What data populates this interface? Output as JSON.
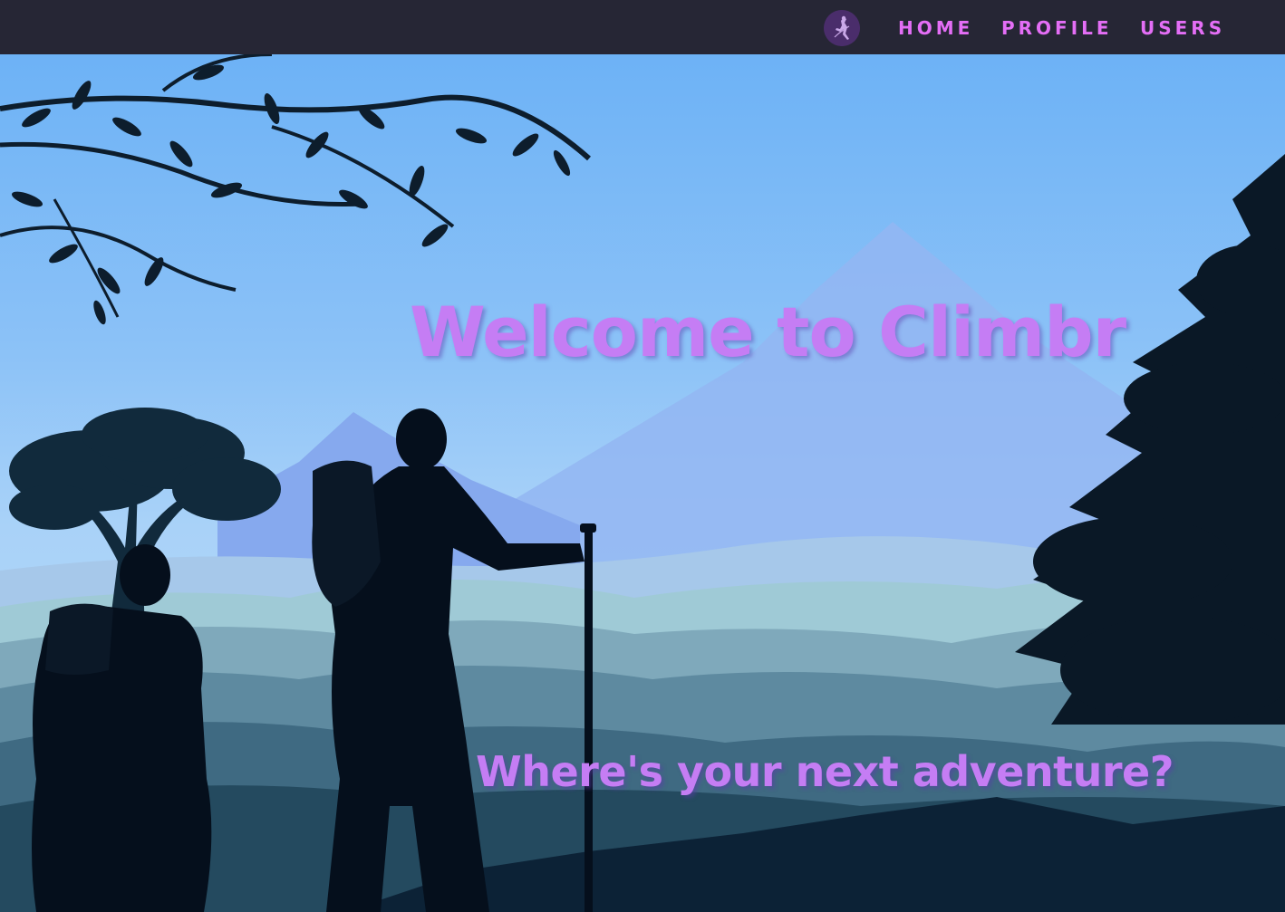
{
  "nav": {
    "logo_icon": "climber-icon",
    "links": [
      {
        "label": "HOME"
      },
      {
        "label": "PROFILE"
      },
      {
        "label": "USERS"
      }
    ]
  },
  "hero": {
    "title": "Welcome to Climbr",
    "tagline": "Where's your next adventure?"
  },
  "colors": {
    "navbar_bg": "#262635",
    "nav_link": "#e46ef6",
    "headline": "#c57df4",
    "sky_top": "#6fb3f5",
    "silhouette": "#06111f"
  }
}
